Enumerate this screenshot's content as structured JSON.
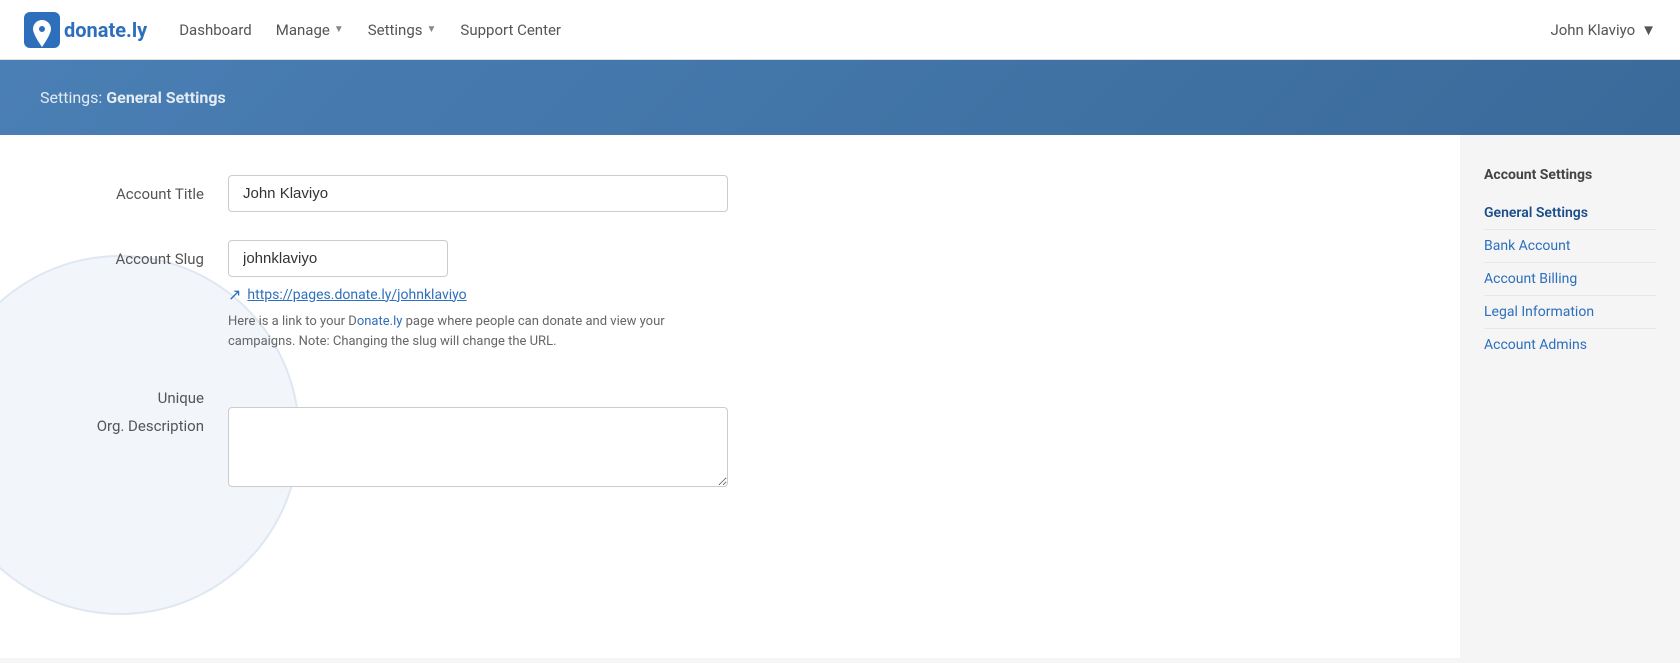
{
  "navbar": {
    "logo_text": "donate.ly",
    "links": [
      {
        "label": "Dashboard",
        "has_arrow": false
      },
      {
        "label": "Manage",
        "has_arrow": true
      },
      {
        "label": "Settings",
        "has_arrow": true
      },
      {
        "label": "Support Center",
        "has_arrow": false
      }
    ],
    "user": {
      "name": "John Klaviyo",
      "has_arrow": true
    }
  },
  "page_header": {
    "breadcrumb_prefix": "Settings:",
    "title": "General Settings"
  },
  "form": {
    "account_title_label": "Account Title",
    "account_title_value": "John Klaviyo",
    "account_slug_label": "Account Slug",
    "account_slug_value": "johnklaviyo",
    "slug_url": "https://pages.donate.ly/johnklaviyo",
    "slug_description_part1": "Here is a link to your D",
    "slug_description_part2": "ate page where people can donate and view your campaigns. Note: Changing the slug will change the URL.",
    "slug_url_display": "https://pages.donate.ly/johnklaviyo",
    "unique_label": "Unique",
    "org_description_label": "Org. Description",
    "org_description_placeholder": ""
  },
  "account_settings_sidebar": {
    "title": "Account Settings",
    "items": [
      {
        "label": "General Settings",
        "active": true
      },
      {
        "label": "Bank Account",
        "active": false
      },
      {
        "label": "Account Billing",
        "active": false
      },
      {
        "label": "Legal Information",
        "active": false
      },
      {
        "label": "Account Admins",
        "active": false
      }
    ]
  }
}
